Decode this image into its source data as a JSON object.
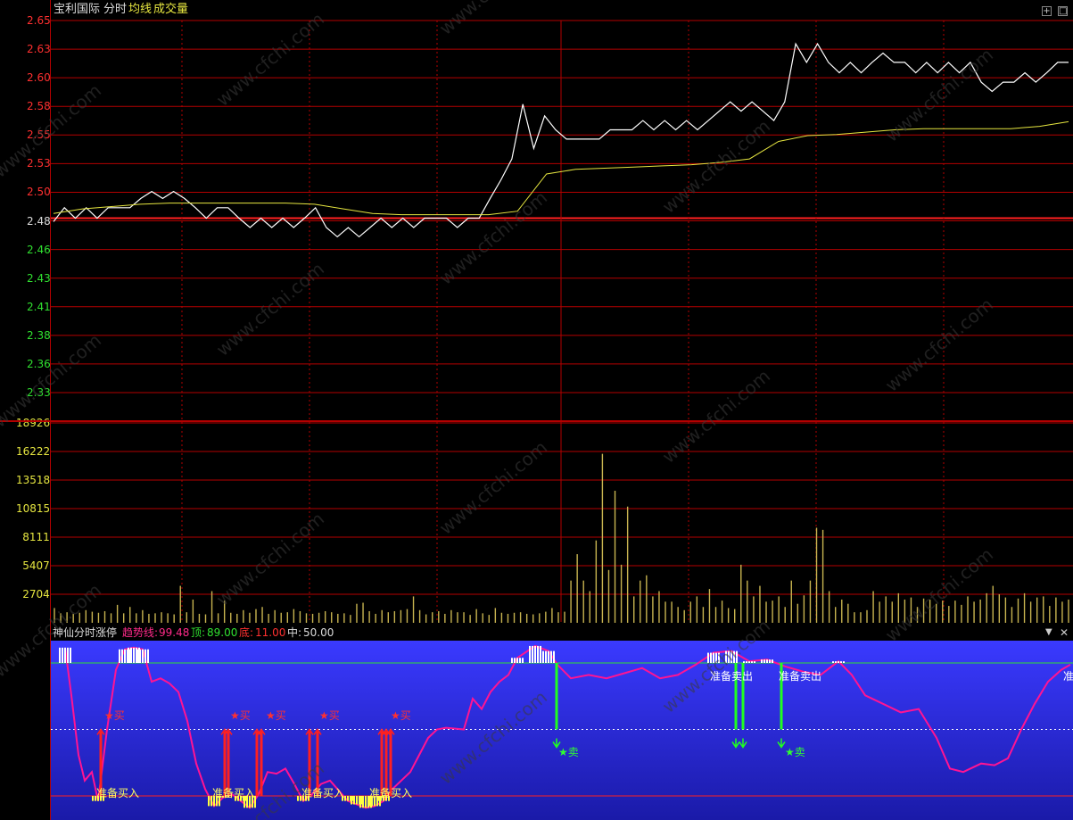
{
  "header": {
    "stock_name": "宝利国际",
    "mode": "分时",
    "avg_label": "均线",
    "vol_label": "成交量"
  },
  "price_axis": {
    "ticks": [
      "2.65",
      "2.63",
      "2.60",
      "2.58",
      "2.55",
      "2.53",
      "2.50",
      "2.48",
      "2.46",
      "2.43",
      "2.41",
      "2.38",
      "2.36",
      "2.33"
    ],
    "ref_price": "2.48"
  },
  "volume_axis": {
    "ticks": [
      "18926",
      "16222",
      "13518",
      "10815",
      "8111",
      "5407",
      "2704"
    ]
  },
  "indicator": {
    "name": "神仙分时涨停",
    "trend_label": "趋势线:",
    "trend_value": "99.48",
    "top_label": "顶:",
    "top_value": "89.00",
    "bottom_label": "底:",
    "bottom_value": "11.00",
    "mid_label": "中:",
    "mid_value": "50.00",
    "buy_prep": "准备买入",
    "sell_prep": "准备卖出",
    "buy_mark": "★买",
    "sell_mark": "★卖"
  },
  "watermark": "www.cfchi.com",
  "colors": {
    "grid": "#b40000",
    "price_line": "#ffffff",
    "avg_line": "#e6e640",
    "volume": "#c8b450",
    "up_label": "#ff3030",
    "down_label": "#30e030",
    "trend_line": "#ff1493",
    "panel_top": "#3a3aff",
    "panel_bottom": "#1a1aa8"
  },
  "chart_data": {
    "type": "line",
    "series": [
      {
        "values": [
          2.477,
          2.489,
          2.48,
          2.489,
          2.48,
          2.489,
          2.489,
          2.489,
          2.497,
          2.503,
          2.497,
          2.503,
          2.497,
          2.489,
          2.48,
          2.489,
          2.489,
          2.48,
          2.472,
          2.48,
          2.472,
          2.48,
          2.472,
          2.48,
          2.489,
          2.472,
          2.464,
          2.472,
          2.464,
          2.472,
          2.48,
          2.472,
          2.48,
          2.472,
          2.48,
          2.48,
          2.48,
          2.472,
          2.48,
          2.48,
          2.497,
          2.513,
          2.531,
          2.578,
          2.54,
          2.568,
          2.556,
          2.548,
          2.548,
          2.548,
          2.548,
          2.556,
          2.556,
          2.556,
          2.564,
          2.556,
          2.564,
          2.556,
          2.564,
          2.556,
          2.564,
          2.572,
          2.58,
          2.572,
          2.58,
          2.572,
          2.564,
          2.58,
          2.63,
          2.614,
          2.63,
          2.614,
          2.605,
          2.614,
          2.605,
          2.614,
          2.622,
          2.614,
          2.614,
          2.605,
          2.614,
          2.605,
          2.614,
          2.605,
          2.614,
          2.597,
          2.589,
          2.597,
          2.597,
          2.605,
          2.597,
          2.605,
          2.614,
          2.614
        ]
      },
      {
        "values": [
          2.484,
          2.488,
          2.49,
          2.492,
          2.493,
          2.493,
          2.493,
          2.493,
          2.493,
          2.492,
          2.488,
          2.484,
          2.483,
          2.483,
          2.483,
          2.483,
          2.486,
          2.518,
          2.522,
          2.523,
          2.524,
          2.525,
          2.526,
          2.528,
          2.531,
          2.546,
          2.551,
          2.552,
          2.554,
          2.556,
          2.557,
          2.557,
          2.557,
          2.557,
          2.559,
          2.563
        ]
      }
    ],
    "ylim": [
      2.32,
      2.65
    ],
    "volume": [
      1400,
      900,
      1000,
      850,
      950,
      1200,
      1050,
      950,
      1100,
      900,
      1700,
      900,
      1500,
      900,
      1200,
      850,
      900,
      1000,
      900,
      800,
      3500,
      1000,
      2200,
      850,
      800,
      3000,
      900,
      2100,
      950,
      850,
      1200,
      950,
      1300,
      1500,
      850,
      1200,
      950,
      1000,
      1300,
      1100,
      900,
      850,
      950,
      1100,
      1000,
      850,
      900,
      750,
      1800,
      1900,
      1100,
      850,
      1200,
      1000,
      1100,
      1200,
      1300,
      2500,
      1200,
      800,
      1000,
      1100,
      850,
      1200,
      1000,
      1000,
      750,
      1300,
      900,
      750,
      1400,
      950,
      850,
      950,
      1000,
      850,
      800,
      900,
      1050,
      1400,
      1000,
      1050,
      4000,
      6500,
      4000,
      3000,
      7800,
      16000,
      5000,
      12500,
      5500,
      11000,
      2500,
      4000,
      4500,
      2500,
      3000,
      2000,
      2000,
      1500,
      1200,
      2000,
      2500,
      1500,
      3200,
      1500,
      2100,
      1400,
      1300,
      5500,
      4000,
      2500,
      3500,
      2000,
      2100,
      2500,
      1500,
      4000,
      1800,
      2600,
      4000,
      9000,
      8800,
      3000,
      1500,
      2200,
      1800,
      1000,
      1000,
      1200,
      3000,
      2000,
      2500,
      2000,
      2800,
      2200,
      2400,
      1500,
      2300,
      2200,
      1800,
      2100,
      1600,
      2100,
      1700,
      2500,
      2000,
      2200,
      2800,
      3500,
      2700,
      2400,
      1500,
      2300,
      2800,
      2000,
      2400,
      2500,
      1600,
      2400,
      2000,
      2200
    ],
    "volume_ylim": [
      0,
      18926
    ],
    "indicator_top": 89.0,
    "indicator_bottom": 11.0,
    "indicator_mid": 50.0,
    "indicator_last": 99.48
  }
}
